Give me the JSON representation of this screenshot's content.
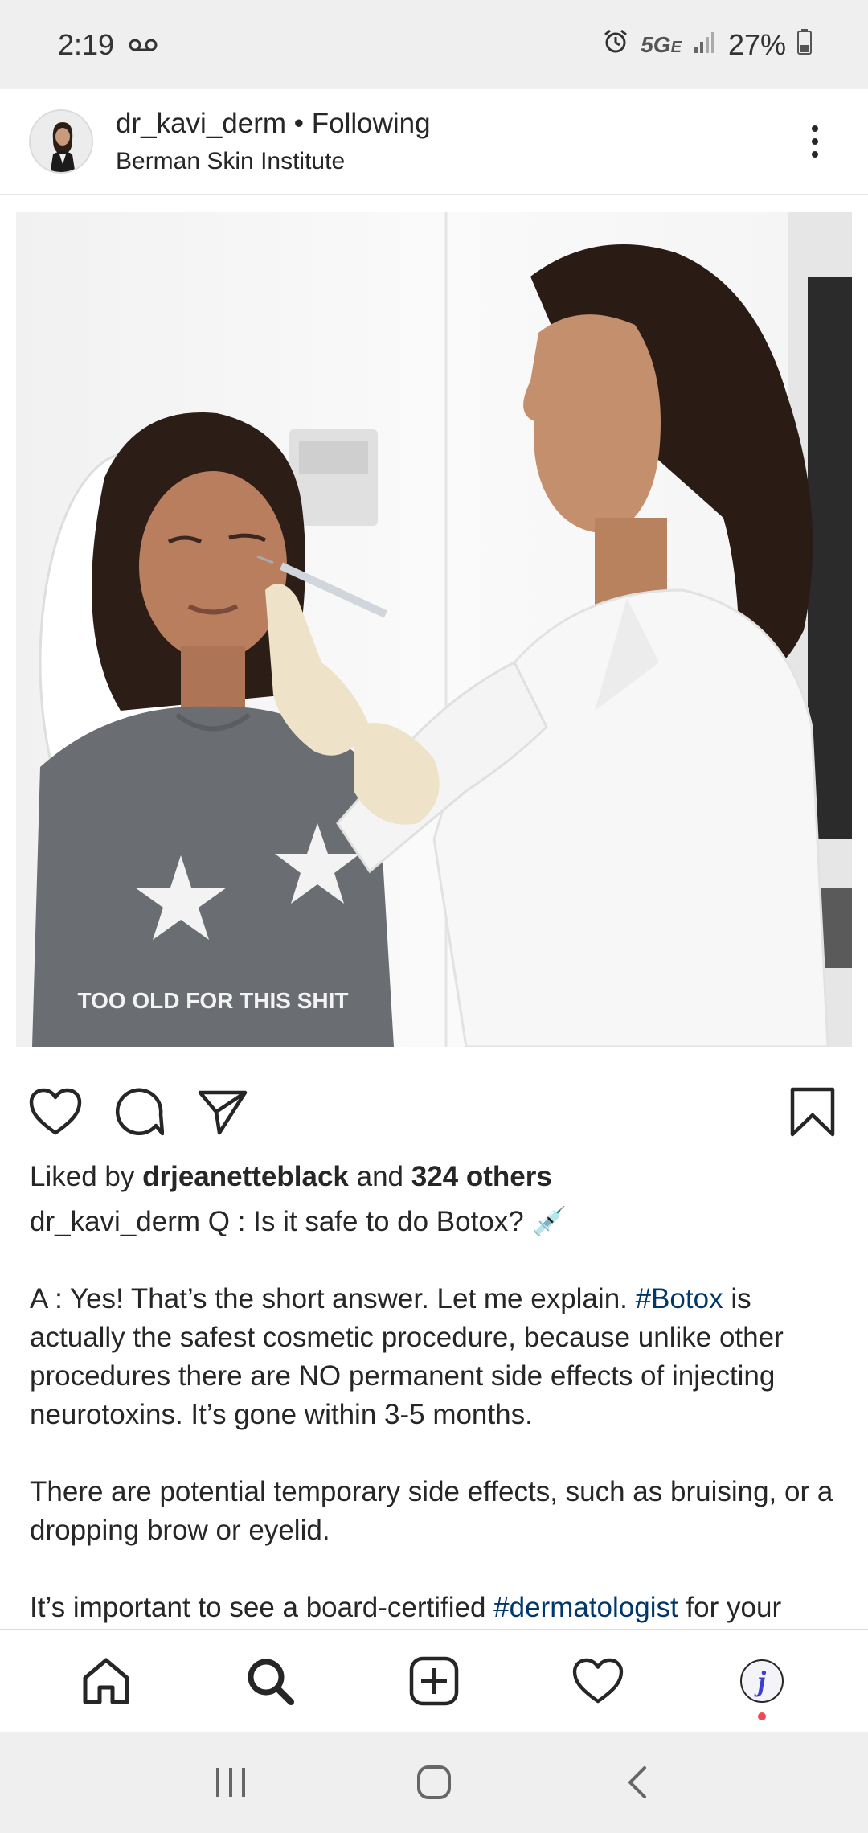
{
  "status_bar": {
    "time": "2:19",
    "network": "5G",
    "network_sub": "E",
    "battery": "27%"
  },
  "post": {
    "username": "dr_kavi_derm",
    "separator": " • ",
    "follow_status": "Following",
    "location": "Berman Skin Institute"
  },
  "engagement": {
    "liked_by_prefix": "Liked by ",
    "liked_by_user": "drjeanetteblack",
    "liked_by_mid": " and ",
    "others": "324 others"
  },
  "caption": {
    "author": "dr_kavi_derm",
    "question": " Q : Is it safe to do Botox? 💉",
    "p1_a": "A : Yes! That’s the short answer. Let me explain. ",
    "p1_tag": "#Botox",
    "p1_b": " is actually the safest cosmetic procedure, because unlike other procedures there are NO permanent side effects of injecting neurotoxins. It’s gone within 3-5 months.",
    "p2": "There are potential temporary side effects, such as bruising, or a dropping brow or eyelid.",
    "p3_a": "It’s important to see a board-certified ",
    "p3_tag": "#dermatologist",
    "p3_b": " for your"
  },
  "photo": {
    "shirt_text": "TOO OLD FOR THIS SHIT"
  },
  "profile_initial": "j",
  "colors": {
    "hashtag": "#00376b",
    "notification_dot": "#ed4956",
    "system_bar": "#efefef"
  },
  "icons": {
    "actions": [
      "heart-icon",
      "comment-icon",
      "share-icon",
      "bookmark-icon"
    ],
    "nav": [
      "home-icon",
      "search-icon",
      "add-post-icon",
      "activity-heart-icon",
      "profile-avatar"
    ]
  }
}
